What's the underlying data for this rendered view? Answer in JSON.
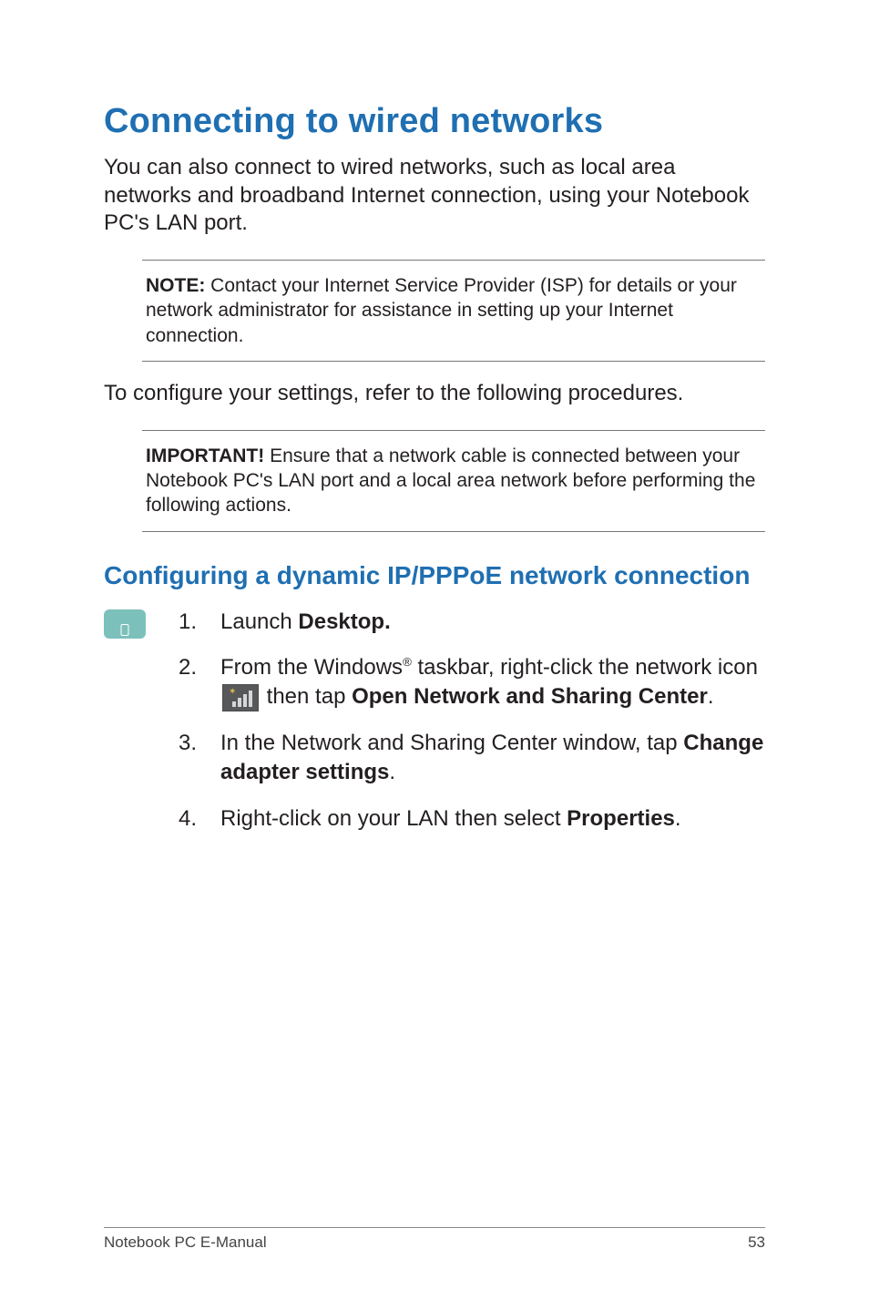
{
  "heading": "Connecting to wired networks",
  "intro": "You can also connect to wired networks, such as local area networks and broadband Internet connection, using your Notebook PC's LAN port.",
  "note": {
    "label": "NOTE:",
    "text": " Contact your Internet Service Provider (ISP) for details or your network administrator for assistance in setting up your Internet connection."
  },
  "midText": "To configure your settings, refer to the following procedures.",
  "important": {
    "label": "IMPORTANT!",
    "text": "  Ensure that a network cable is connected between your Notebook PC's LAN port and a local area network before performing the following actions."
  },
  "subheading": "Configuring a dynamic IP/PPPoE network connection",
  "steps": {
    "s1": {
      "pre": "Launch ",
      "bold": "Desktop."
    },
    "s2": {
      "pre": "From the Windows",
      "reg": "®",
      "mid1": " taskbar, right-click the network icon ",
      "mid2": " then tap ",
      "bold1": "Open Network and Sharing Center",
      "post": "."
    },
    "s3": {
      "pre": "In the Network and Sharing Center window, tap ",
      "bold": "Change adapter settings",
      "post": "."
    },
    "s4": {
      "pre": "Right-click on your LAN then select ",
      "bold": "Properties",
      "post": "."
    }
  },
  "footer": {
    "left": "Notebook PC E-Manual",
    "right": "53"
  }
}
